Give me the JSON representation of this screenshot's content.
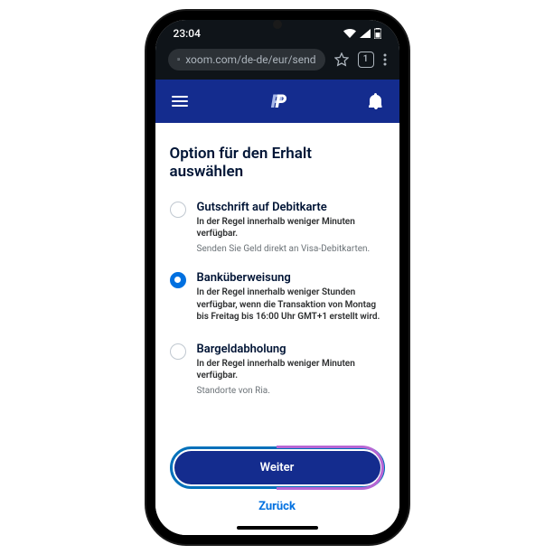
{
  "status_bar": {
    "time": "23:04"
  },
  "browser": {
    "url": "xoom.com/de-de/eur/send",
    "tab_count": "1"
  },
  "page": {
    "title": "Option für den Erhalt auswählen"
  },
  "options": [
    {
      "title": "Gutschrift auf Debitkarte",
      "desc": "In der Regel innerhalb weniger Minuten verfügbar.",
      "note": "Senden Sie Geld direkt an Visa-Debitkarten.",
      "selected": false
    },
    {
      "title": "Banküberweisung",
      "desc": "In der Regel innerhalb weniger Stunden verfügbar, wenn die Transaktion von Montag bis Freitag bis 16:00 Uhr GMT+1 erstellt wird.",
      "note": "",
      "selected": true
    },
    {
      "title": "Bargeldabholung",
      "desc": "In der Regel innerhalb weniger Minuten verfügbar.",
      "note": "Standorte von Ria.",
      "selected": false
    }
  ],
  "footer": {
    "primary_label": "Weiter",
    "back_label": "Zurück"
  }
}
